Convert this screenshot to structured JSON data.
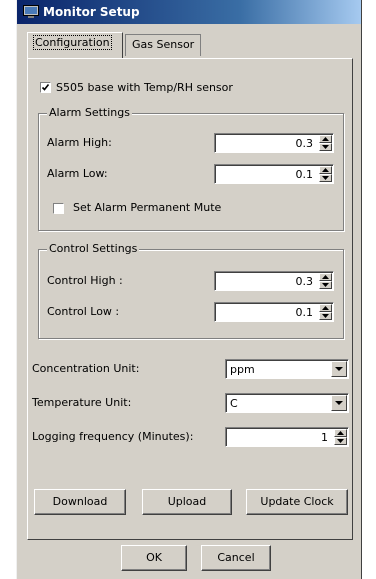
{
  "window": {
    "title": "Monitor Setup"
  },
  "tabs": [
    {
      "label": "Configuration",
      "active": true
    },
    {
      "label": "Gas Sensor",
      "active": false
    }
  ],
  "sensor_checkbox": {
    "label": "S505 base with Temp/RH sensor",
    "checked": true
  },
  "alarm_settings": {
    "legend": "Alarm Settings",
    "high_label": "Alarm High:",
    "high_value": "0.3",
    "low_label": "Alarm Low:",
    "low_value": "0.1",
    "mute_label": "Set Alarm Permanent Mute",
    "mute_checked": false
  },
  "control_settings": {
    "legend": "Control Settings",
    "high_label": "Control High :",
    "high_value": "0.3",
    "low_label": "Control Low :",
    "low_value": "0.1"
  },
  "concentration_unit": {
    "label": "Concentration Unit:",
    "value": "ppm"
  },
  "temperature_unit": {
    "label": "Temperature Unit:",
    "value": "C"
  },
  "logging_frequency": {
    "label": "Logging frequency (Minutes):",
    "value": "1"
  },
  "buttons": {
    "download": "Download",
    "upload": "Upload",
    "update_clock": "Update Clock",
    "ok": "OK",
    "cancel": "Cancel"
  },
  "icons": {
    "window_icon": "monitor-setup-icon",
    "spin_up": "spin-up-arrow-icon",
    "spin_down": "spin-down-arrow-icon",
    "dropdown": "dropdown-arrow-icon",
    "check": "checkmark-icon"
  },
  "colors": {
    "titlebar_start": "#0a246a",
    "titlebar_end": "#a6caf0",
    "face": "#d4d0c8"
  }
}
